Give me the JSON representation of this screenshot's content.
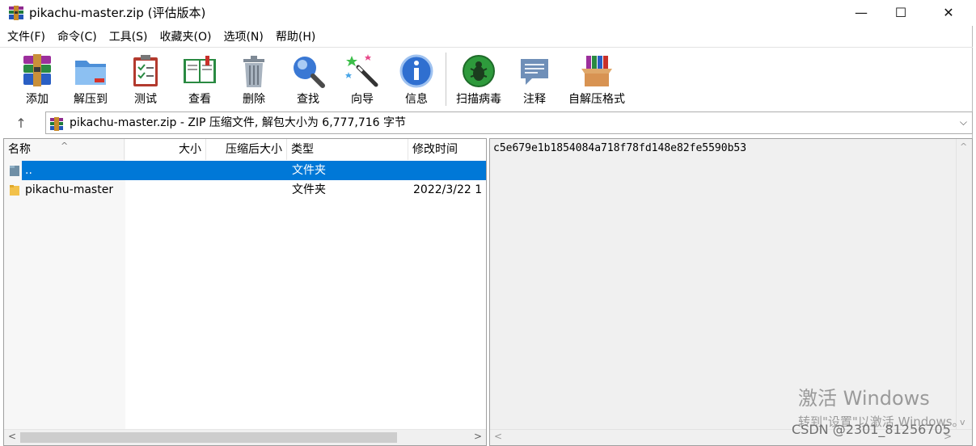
{
  "window": {
    "title": "pikachu-master.zip (评估版本)",
    "controls": {
      "minimize": "—",
      "maximize": "☐",
      "close": "✕"
    }
  },
  "menubar": {
    "items": [
      "文件(F)",
      "命令(C)",
      "工具(S)",
      "收藏夹(O)",
      "选项(N)",
      "帮助(H)"
    ]
  },
  "toolbar": {
    "buttons": [
      {
        "label": "添加",
        "icon": "add-archive-icon"
      },
      {
        "label": "解压到",
        "icon": "extract-to-folder-icon"
      },
      {
        "label": "测试",
        "icon": "test-clipboard-icon"
      },
      {
        "label": "查看",
        "icon": "view-book-icon"
      },
      {
        "label": "删除",
        "icon": "trash-can-icon"
      },
      {
        "label": "查找",
        "icon": "magnifier-icon"
      },
      {
        "label": "向导",
        "icon": "magic-wand-icon"
      },
      {
        "label": "信息",
        "icon": "info-icon"
      },
      {
        "label": "扫描病毒",
        "icon": "virus-scan-icon"
      },
      {
        "label": "注释",
        "icon": "comment-icon"
      },
      {
        "label": "自解压格式",
        "icon": "sfx-box-icon"
      }
    ]
  },
  "addressbar": {
    "up_symbol": "↑",
    "path": "pikachu-master.zip - ZIP 压缩文件, 解包大小为 6,777,716 字节",
    "dropdown_symbol": "⌵"
  },
  "filelist": {
    "sort_indicator": "^",
    "columns": [
      "名称",
      "大小",
      "压缩后大小",
      "类型",
      "修改时间"
    ],
    "rows": [
      {
        "name": "..",
        "size": "",
        "packed": "",
        "type": "文件夹",
        "modified": "",
        "selected": true
      },
      {
        "name": "pikachu-master",
        "size": "",
        "packed": "",
        "type": "文件夹",
        "modified": "2022/3/22 1",
        "selected": false
      }
    ]
  },
  "comment": {
    "text": "c5e679e1b1854084a718f78fd148e82fe5590b53"
  },
  "overlay": {
    "activation_title": "激活 Windows",
    "activation_hint": "转到\"设置\"以激活 Windows。",
    "watermark": "CSDN @2301_81256705"
  },
  "colors": {
    "selection": "#0078d7",
    "comment_bg": "#f0f0f0",
    "name_column_bg": "#f7f7f7"
  }
}
